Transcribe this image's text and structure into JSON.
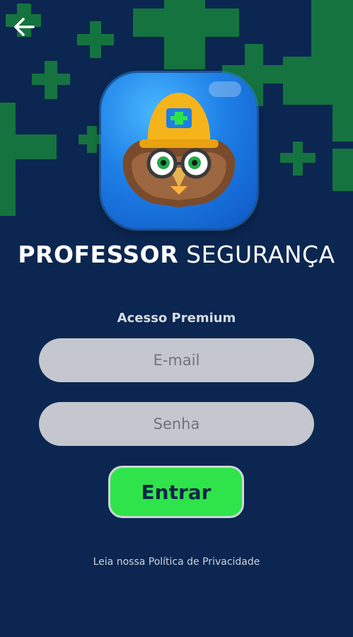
{
  "header": {
    "back_icon": "arrow-left-icon"
  },
  "app_icon": {
    "name": "owl-mascot-hardhat-icon",
    "colors": {
      "primary": "#1e7fe6",
      "helmet": "#f5b41a",
      "cross": "#2fe44a"
    }
  },
  "brand": {
    "title_bold": "PROFESSOR",
    "title_light": "SEGURANÇA"
  },
  "form": {
    "section_title": "Acesso Premium",
    "email_placeholder": "E-mail",
    "password_placeholder": "Senha",
    "submit_label": "Entrar"
  },
  "footer": {
    "privacy_link": "Leia nossa Política de Privacidade"
  },
  "colors": {
    "background": "#0b2650",
    "accent": "#2fe44a",
    "cross_bg": "#1a7a3e"
  }
}
